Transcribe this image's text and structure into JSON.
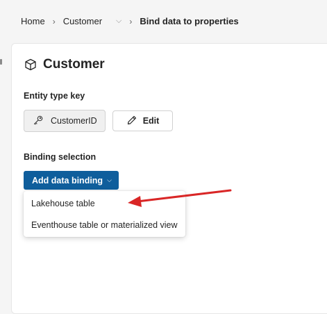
{
  "breadcrumb": {
    "items": [
      "Home",
      "Customer",
      "Bind data to properties"
    ]
  },
  "page": {
    "title": "Customer"
  },
  "entity_key": {
    "section_label": "Entity type key",
    "key_value": "CustomerID",
    "edit_label": "Edit"
  },
  "binding": {
    "section_label": "Binding selection",
    "add_button_label": "Add data binding",
    "menu_items": [
      "Lakehouse table",
      "Eventhouse table or materialized view"
    ]
  },
  "icons": {
    "title_icon": "cube-icon",
    "key_icon": "key-icon",
    "edit_icon": "pencil-icon",
    "annotation": "red-arrow-annotation"
  },
  "colors": {
    "primary": "#0f5e9c",
    "arrow": "#d92626"
  }
}
